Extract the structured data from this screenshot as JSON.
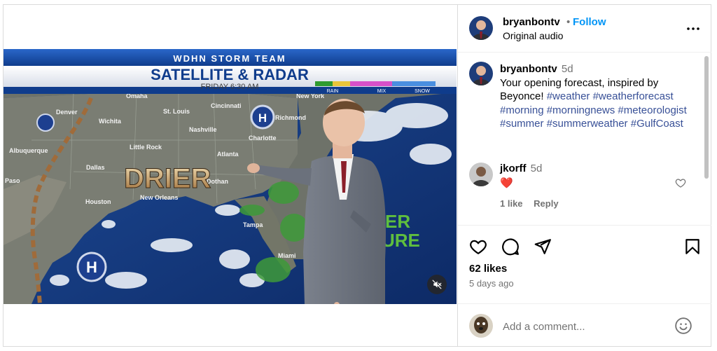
{
  "media": {
    "broadcast": {
      "station": "WDHN STORM TEAM",
      "title": "SATELLITE & RADAR",
      "time": "FRIDAY 6:30 AM",
      "legend": [
        "RAIN",
        "MIX",
        "SNOW"
      ],
      "big_word": "DRIER",
      "side_text": "ER",
      "side_text_2": "URE",
      "cities": [
        "Omaha",
        "Denver",
        "Wichita",
        "St. Louis",
        "Cincinnati",
        "Richmond",
        "Nashville",
        "Charlotte",
        "Little Rock",
        "Atlanta",
        "Albuquerque",
        "Dallas",
        "Paso",
        "Dothan",
        "Houston",
        "New Orleans",
        "Tampa",
        "Miami",
        "New York"
      ],
      "pressure_marker": "H"
    },
    "mute_icon": "speaker-muted-icon"
  },
  "header": {
    "username": "bryanbontv",
    "separator": "•",
    "follow": "Follow",
    "audio": "Original audio",
    "more_icon": "more-horizontal-icon"
  },
  "caption": {
    "username": "bryanbontv",
    "age": "5d",
    "text": "Your opening forecast, inspired by Beyonce!",
    "hashtags": "#weather #weatherforecast #morning #morningnews #meteorologist #summer #summerweather #GulfCoast"
  },
  "comment": {
    "username": "jkorff",
    "age": "5d",
    "text": "❤️",
    "likes": "1 like",
    "reply": "Reply"
  },
  "actions": {
    "like_icon": "heart-outline-icon",
    "comment_icon": "comment-bubble-icon",
    "share_icon": "paper-plane-icon",
    "save_icon": "bookmark-icon",
    "likes": "62 likes",
    "time": "5 days ago"
  },
  "add_comment": {
    "placeholder": "Add a comment...",
    "emoji_icon": "emoji-smiley-icon"
  },
  "colors": {
    "link_blue": "#0095f6",
    "hashtag_blue": "#385097",
    "secondary_text": "#737373"
  }
}
